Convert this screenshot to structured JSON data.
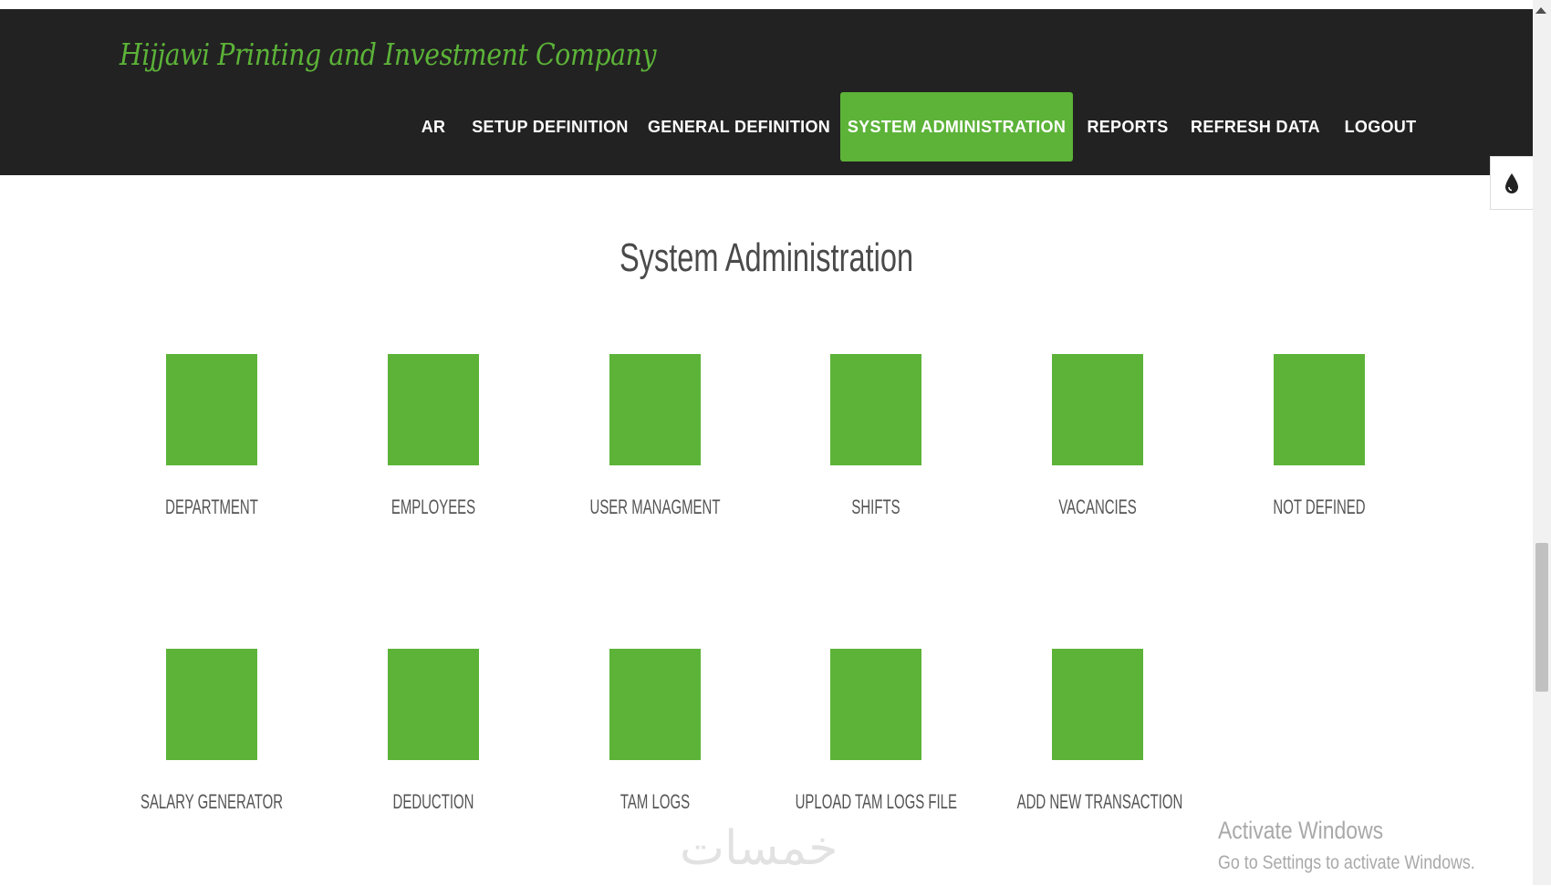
{
  "brand": {
    "title": "Hijjawi Printing and Investment Company"
  },
  "nav": {
    "items": [
      {
        "label": "AR"
      },
      {
        "label": "SETUP DEFINITION"
      },
      {
        "label": "GENERAL DEFINITION"
      },
      {
        "label": "SYSTEM ADMINISTRATION"
      },
      {
        "label": "REPORTS"
      },
      {
        "label": "REFRESH DATA"
      },
      {
        "label": "LOGOUT"
      }
    ],
    "active_index": 3
  },
  "theme_toggle": {
    "icon": "drop-icon"
  },
  "page": {
    "title": "System Administration"
  },
  "tiles": [
    {
      "label": "DEPARTMENT"
    },
    {
      "label": "EMPLOYEES"
    },
    {
      "label": "USER MANAGMENT"
    },
    {
      "label": "SHIFTS"
    },
    {
      "label": "VACANCIES"
    },
    {
      "label": "NOT DEFINED"
    },
    {
      "label": "SALARY GENERATOR"
    },
    {
      "label": "DEDUCTION"
    },
    {
      "label": "TAM LOGS"
    },
    {
      "label": "UPLOAD TAM LOGS FILE"
    },
    {
      "label": "ADD NEW TRANSACTION"
    }
  ],
  "overlay": {
    "activate_title": "Activate Windows",
    "activate_subtitle": "Go to Settings to activate Windows.",
    "watermark": "خمسات"
  },
  "colors": {
    "accent": "#5cb338",
    "navbar": "#222222",
    "text": "#555555"
  }
}
